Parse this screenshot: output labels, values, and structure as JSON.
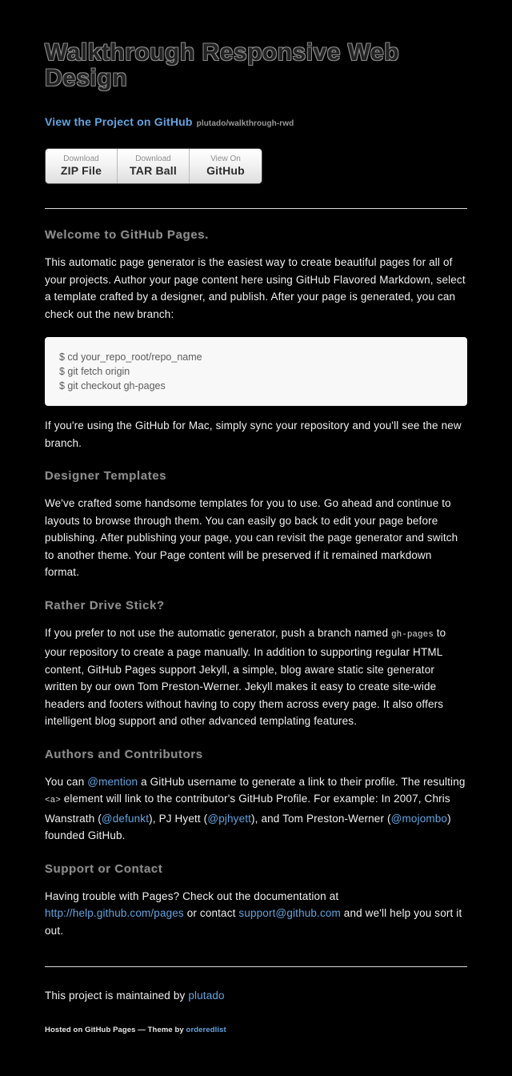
{
  "header": {
    "site_title": "Walkthrough Responsive Web Design",
    "tagline_link": "View the Project on GitHub",
    "tagline_repo": "plutado/walkthrough-rwd",
    "buttons": [
      {
        "top": "Download",
        "bottom": "ZIP File",
        "name": "download-zip-button"
      },
      {
        "top": "Download",
        "bottom": "TAR Ball",
        "name": "download-tar-button"
      },
      {
        "top": "View On",
        "bottom": "GitHub",
        "name": "view-on-github-button"
      }
    ]
  },
  "sections": {
    "welcome": {
      "heading": "Welcome to GitHub Pages.",
      "paragraph": "This automatic page generator is the easiest way to create beautiful pages for all of your projects. Author your page content here using GitHub Flavored Markdown, select a template crafted by a designer, and publish. After your page is generated, you can check out the new branch:",
      "code": "$ cd your_repo_root/repo_name\n$ git fetch origin\n$ git checkout gh-pages",
      "after_code": "If you're using the GitHub for Mac, simply sync your repository and you'll see the new branch."
    },
    "designer": {
      "heading": "Designer Templates",
      "paragraph": "We've crafted some handsome templates for you to use. Go ahead and continue to layouts to browse through them. You can easily go back to edit your page before publishing. After publishing your page, you can revisit the page generator and switch to another theme. Your Page content will be preserved if it remained markdown format."
    },
    "stick": {
      "heading": "Rather Drive Stick?",
      "p1": "If you prefer to not use the automatic generator, push a branch named ",
      "code1": "gh-pages",
      "p2": " to your repository to create a page manually. In addition to supporting regular HTML content, GitHub Pages support Jekyll, a simple, blog aware static site generator written by our own Tom Preston-Werner. Jekyll makes it easy to create site-wide headers and footers without having to copy them across every page. It also offers intelligent blog support and other advanced templating features."
    },
    "authors": {
      "heading": "Authors and Contributors",
      "p1": "You can ",
      "link1": "@mention",
      "p2": " a GitHub username to generate a link to their profile. The resulting ",
      "code1": "<a>",
      "p3": " element will link to the contributor's GitHub Profile. For example: In 2007, Chris Wanstrath (",
      "link2": "@defunkt",
      "p4": "), PJ Hyett (",
      "link3": "@pjhyett",
      "p5": "), and Tom Preston-Werner (",
      "link4": "@mojombo",
      "p6": ") founded GitHub."
    },
    "support": {
      "heading": "Support or Contact",
      "p1": "Having trouble with Pages? Check out the documentation at ",
      "link1": "http://help.github.com/pages",
      "p2": " or contact ",
      "link2": "support@github.com",
      "p3": " and we'll help you sort it out."
    }
  },
  "footer": {
    "maintained_prefix": "This project is maintained by ",
    "maintainer_link": "plutado",
    "credits_prefix": "Hosted on GitHub Pages — Theme by ",
    "credits_link": "orderedlist"
  },
  "colors": {
    "background": "#000000",
    "link": "#63a4e0",
    "heading": "#8e8e8e",
    "body_text": "#f0f0f0",
    "code_bg": "#f8f8f8",
    "rule": "#d9d9d9"
  }
}
